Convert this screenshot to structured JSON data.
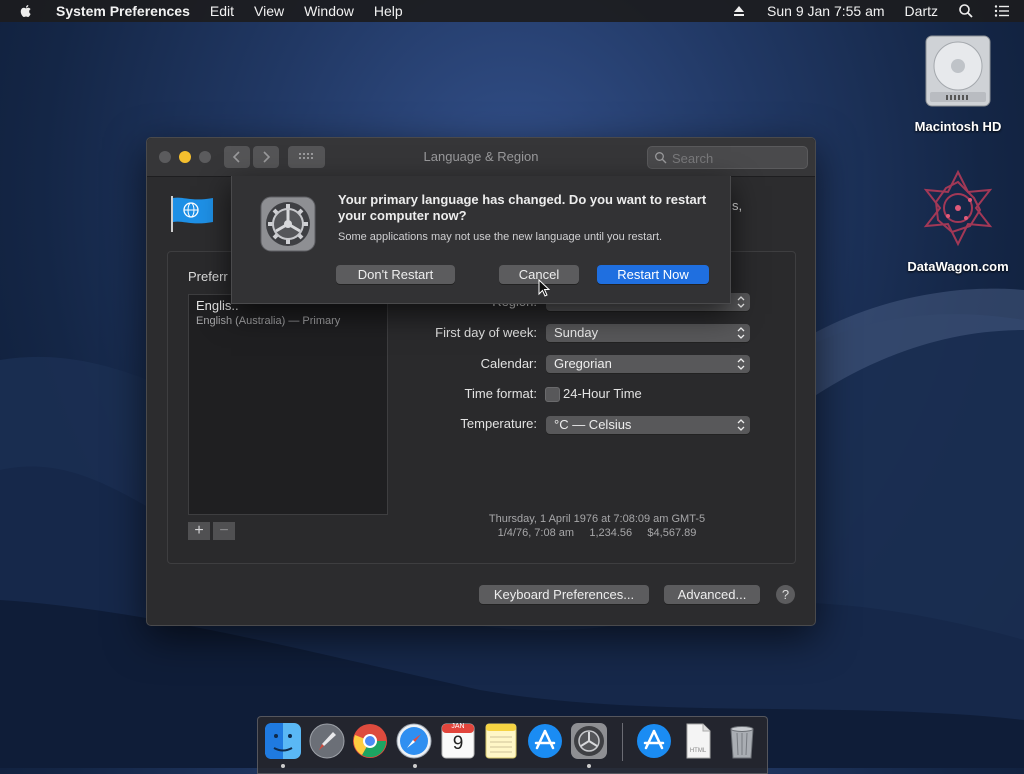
{
  "menubar": {
    "app_name": "System Preferences",
    "menus": [
      "Edit",
      "View",
      "Window",
      "Help"
    ],
    "datetime": "Sun 9 Jan  7:55 am",
    "user": "Dartz"
  },
  "desktop": {
    "icons": [
      {
        "label": "Macintosh HD"
      },
      {
        "label": "DataWagon.com"
      }
    ]
  },
  "window": {
    "title": "Language & Region",
    "search_placeholder": "Search",
    "subtext_fragment": "s,",
    "preferred_label": "Preferr",
    "language_list": {
      "name": "Englis..",
      "detail": "English (Australia) — Primary"
    },
    "add_label": "+",
    "remove_label": "−",
    "rows": {
      "region_label": "Region:",
      "first_day_label": "First day of week:",
      "first_day_value": "Sunday",
      "calendar_label": "Calendar:",
      "calendar_value": "Gregorian",
      "time_format_label": "Time format:",
      "time_format_checkbox": "24-Hour Time",
      "temperature_label": "Temperature:",
      "temperature_value": "°C — Celsius"
    },
    "sample_line1": "Thursday, 1 April 1976 at 7:08:09 am GMT-5",
    "sample_line2": "1/4/76, 7:08 am     1,234.56     $4,567.89",
    "keyboard_button": "Keyboard Preferences...",
    "advanced_button": "Advanced...",
    "help_label": "?"
  },
  "alert": {
    "message": "Your primary language has changed. Do you want to restart your computer now?",
    "info": "Some applications may not use the new language until you restart.",
    "dont_restart": "Don't Restart",
    "cancel": "Cancel",
    "restart_now": "Restart Now"
  },
  "dock": {
    "items": [
      "finder-icon",
      "launchpad-icon",
      "chrome-icon",
      "safari-icon",
      "calendar-icon",
      "notes-icon",
      "app-store-icon",
      "system-preferences-icon",
      "app-store-downloads-icon",
      "document-icon",
      "trash-icon"
    ],
    "calendar_month": "JAN",
    "calendar_day": "9",
    "document_label": "HTML"
  }
}
